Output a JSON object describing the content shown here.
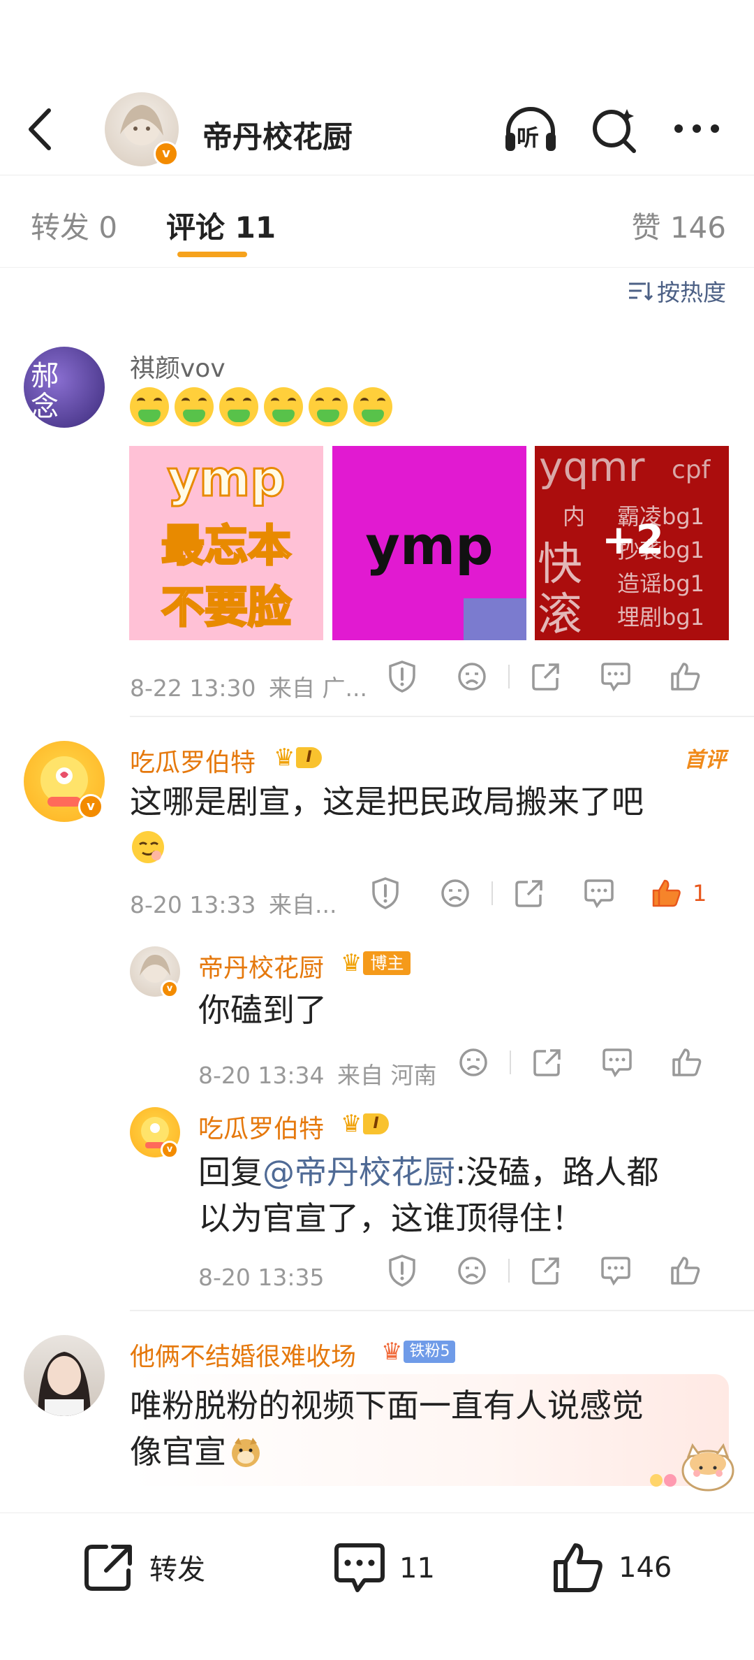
{
  "header": {
    "title": "帝丹校花厨",
    "verified": "v",
    "listen_label": "听"
  },
  "tabs": {
    "repost_label": "转发",
    "repost_count": "0",
    "comment_label": "评论",
    "comment_count": "11",
    "like_label": "赞",
    "like_count": "146"
  },
  "sort_label": "按热度",
  "post": {
    "username": "祺颜vov",
    "avatar_text": "郝念",
    "images": [
      {
        "lines": [
          "ymp",
          "最忘本",
          "不要脸"
        ]
      },
      {
        "lines": [
          "ymp"
        ]
      },
      {
        "lines": [
          "yqmr",
          "cpf",
          "内",
          "霸凌bg1",
          "快",
          "抄袭bg1",
          "滚",
          "造谣bg1",
          "埋剧bg1"
        ],
        "more": "+2"
      }
    ],
    "time": "8-22 13:30",
    "source": "来自 广..."
  },
  "comments": [
    {
      "username": "吃瓜罗伯特",
      "level": "I",
      "first_comment": "首评",
      "text_line1": "这哪是剧宣，这是把民政局搬来了吧",
      "time": "8-20 13:33",
      "source": "来自...",
      "likes": "1"
    }
  ],
  "replies": [
    {
      "username": "帝丹校花厨",
      "badge": "博主",
      "text": "你磕到了",
      "time": "8-20 13:34",
      "source": "来自 河南"
    },
    {
      "username": "吃瓜罗伯特",
      "level": "I",
      "reply_prefix": "回复",
      "mention": "@帝丹校花厨",
      "text_line1": ":没磕，路人都",
      "text_line2": "以为官宣了，这谁顶得住！",
      "time": "8-20 13:35"
    }
  ],
  "comment3": {
    "username": "他俩不结婚很难收场",
    "badge": "铁粉5",
    "text_line1": "唯粉脱粉的视频下面一直有人说感觉",
    "text_line2": "像官宣"
  },
  "bottom_bar": {
    "repost_label": "转发",
    "comment_count": "11",
    "like_count": "146"
  },
  "colors": {
    "accent_orange": "#f6a21c",
    "username_orange": "#e5780c",
    "link_blue": "#4f6a95"
  }
}
